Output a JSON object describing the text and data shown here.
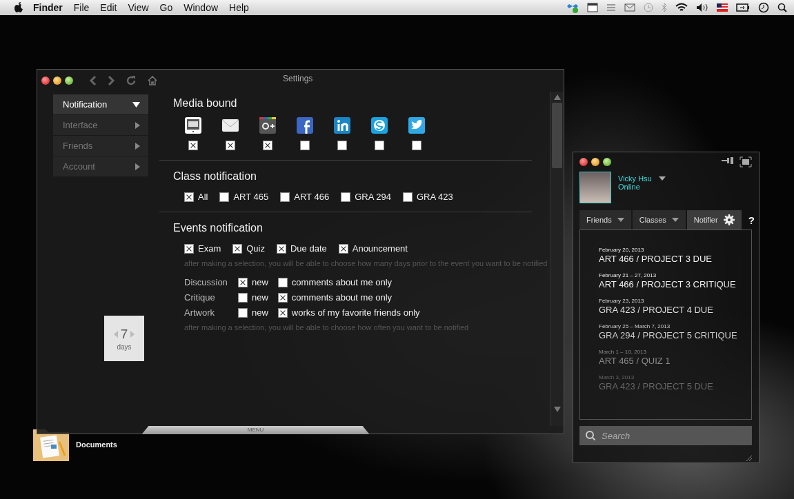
{
  "menu_bar": {
    "app_name": "Finder",
    "menus": [
      "File",
      "Edit",
      "View",
      "Go",
      "Window",
      "Help"
    ]
  },
  "desktop_icons": [
    {
      "label": "Documents",
      "kind": "documents"
    }
  ],
  "settings": {
    "title": "Settings",
    "sidebar": [
      {
        "label": "Notification",
        "selected": true
      },
      {
        "label": "Interface",
        "selected": false
      },
      {
        "label": "Friends",
        "selected": false
      },
      {
        "label": "Account",
        "selected": false
      }
    ],
    "media_bound": {
      "title": "Media bound",
      "services": [
        {
          "kind": "sms",
          "checked": true
        },
        {
          "kind": "mail",
          "checked": true
        },
        {
          "kind": "gplus",
          "checked": true
        },
        {
          "kind": "facebook",
          "checked": false
        },
        {
          "kind": "linkedin",
          "checked": false
        },
        {
          "kind": "skype",
          "checked": false
        },
        {
          "kind": "twitter",
          "checked": false
        }
      ]
    },
    "class_notification": {
      "title": "Class notification",
      "options": [
        {
          "label": "All",
          "checked": true
        },
        {
          "label": "ART 465",
          "checked": false
        },
        {
          "label": "ART 466",
          "checked": false
        },
        {
          "label": "GRA 294",
          "checked": false
        },
        {
          "label": "GRA 423",
          "checked": false
        }
      ]
    },
    "events_notification": {
      "title": "Events notification",
      "types": [
        {
          "label": "Exam",
          "checked": true
        },
        {
          "label": "Quiz",
          "checked": true
        },
        {
          "label": "Due date",
          "checked": true
        },
        {
          "label": "Anouncement",
          "checked": true
        }
      ],
      "days_hint": "after making a selection, you will be able to choose how many days prior to the event you want to be notified",
      "rows": [
        {
          "label": "Discussion",
          "options": [
            {
              "label": "new",
              "checked": true
            },
            {
              "label": "comments about me only",
              "checked": false
            }
          ]
        },
        {
          "label": "Critique",
          "options": [
            {
              "label": "new",
              "checked": false
            },
            {
              "label": "comments about me only",
              "checked": true
            }
          ]
        },
        {
          "label": "Artwork",
          "options": [
            {
              "label": "new",
              "checked": false
            },
            {
              "label": "works of my favorite friends only",
              "checked": true
            }
          ]
        }
      ],
      "often_hint": "after making a selection, you will be able to choose how often you want to be notified"
    },
    "days_picker": {
      "value": "7",
      "unit": "days"
    },
    "menu_tab": "MENU"
  },
  "notifier": {
    "user": {
      "name": "Vicky Hsu",
      "status": "Online"
    },
    "tabs": [
      {
        "label": "Friends",
        "kind": "dropdown",
        "selected": false
      },
      {
        "label": "Classes",
        "kind": "dropdown",
        "selected": false
      },
      {
        "label": "Notifier",
        "kind": "settings",
        "selected": true
      }
    ],
    "help": "?",
    "events": [
      {
        "date": "February 20, 2013",
        "title": "ART 466 / PROJECT 3 DUE"
      },
      {
        "date": "February 21 – 27, 2013",
        "title": "ART 466 / PROJECT 3 CRITIQUE"
      },
      {
        "date": "February 23, 2013",
        "title": "GRA 423 / PROJECT 4 DUE"
      },
      {
        "date": "February 25 – March 7, 2013",
        "title": "GRA 294 / PROJECT 5 CRITIQUE"
      },
      {
        "date": "March 1 – 10, 2013",
        "title": "ART 465 / QUIZ 1"
      },
      {
        "date": "March 3, 2013",
        "title": "GRA 423 / PROJECT 5 DUE"
      }
    ],
    "search": {
      "placeholder": "Search"
    }
  }
}
